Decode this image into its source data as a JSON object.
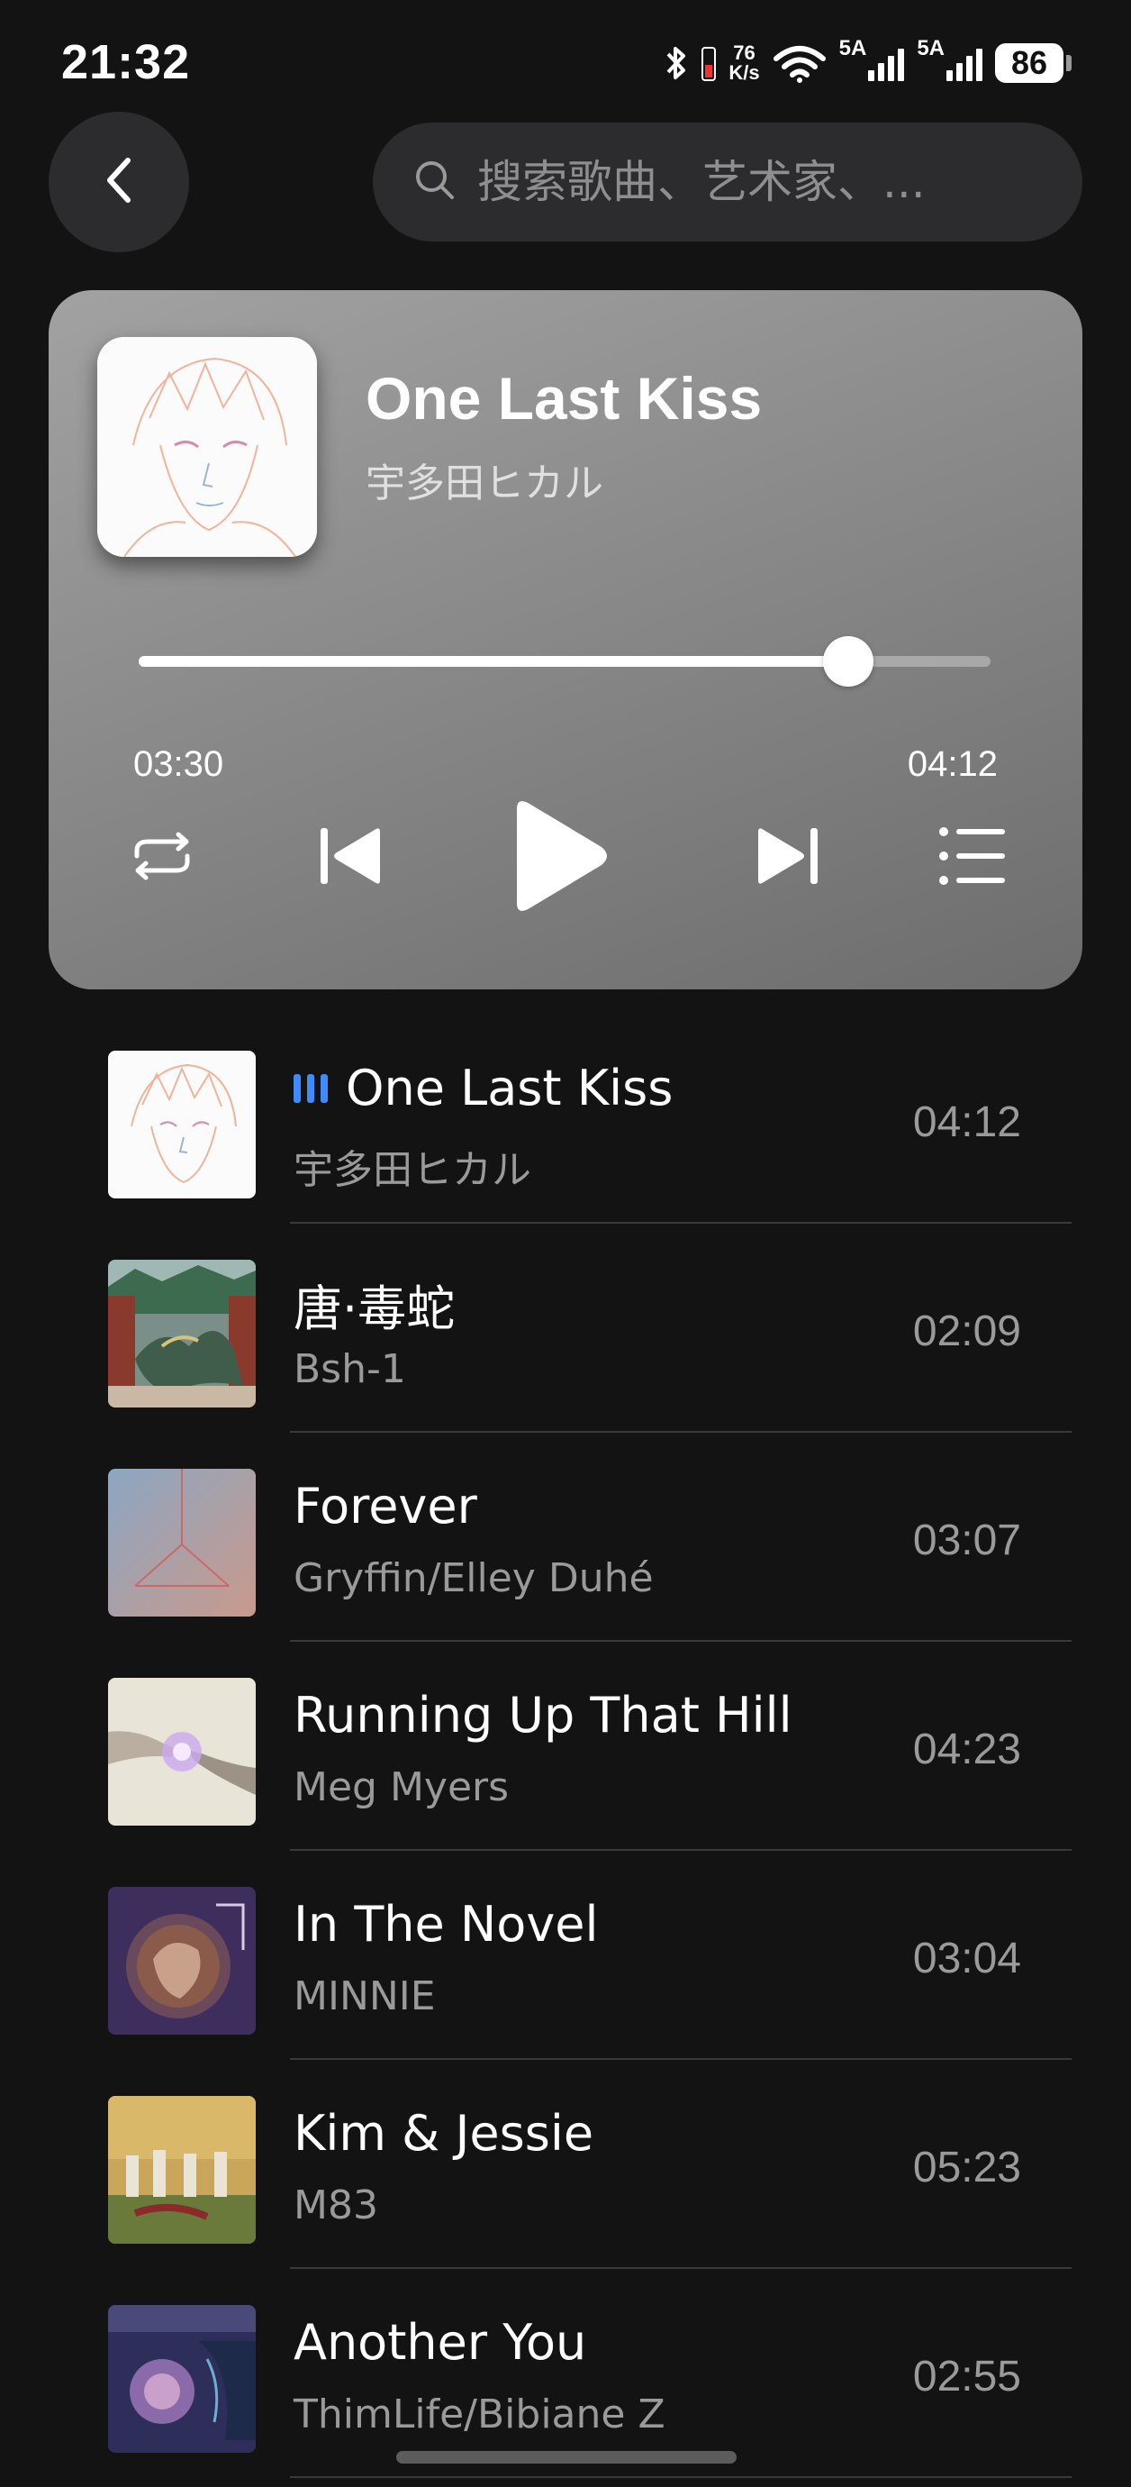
{
  "status_bar": {
    "time": "21:32",
    "net_speed_value": "76",
    "net_speed_unit": "K/s",
    "signal_1_label": "5A",
    "signal_2_label": "5A",
    "battery": "86"
  },
  "search": {
    "placeholder": "搜索歌曲、艺术家、..."
  },
  "now_playing": {
    "title": "One Last Kiss",
    "artist": "宇多田ヒカル",
    "elapsed": "03:30",
    "total": "04:12",
    "progress_fraction": 0.833
  },
  "playlist": [
    {
      "title": "One Last Kiss",
      "artist": "宇多田ヒカル",
      "duration": "04:12",
      "playing": true
    },
    {
      "title": "唐·毒蛇",
      "artist": "Bsh-1",
      "duration": "02:09",
      "playing": false
    },
    {
      "title": "Forever",
      "artist": "Gryffin/Elley Duhé",
      "duration": "03:07",
      "playing": false
    },
    {
      "title": "Running Up That Hill",
      "artist": "Meg Myers",
      "duration": "04:23",
      "playing": false
    },
    {
      "title": "In The Novel",
      "artist": "MINNIE",
      "duration": "03:04",
      "playing": false
    },
    {
      "title": "Kim & Jessie",
      "artist": "M83",
      "duration": "05:23",
      "playing": false
    },
    {
      "title": "Another You",
      "artist": "ThimLife/Bibiane Z",
      "duration": "02:55",
      "playing": false
    }
  ],
  "colors": {
    "background": "#131313",
    "accent_playing": "#3d8bff",
    "card_gradient_top": "#a2a2a2",
    "card_gradient_bottom": "#6d6d6d"
  }
}
